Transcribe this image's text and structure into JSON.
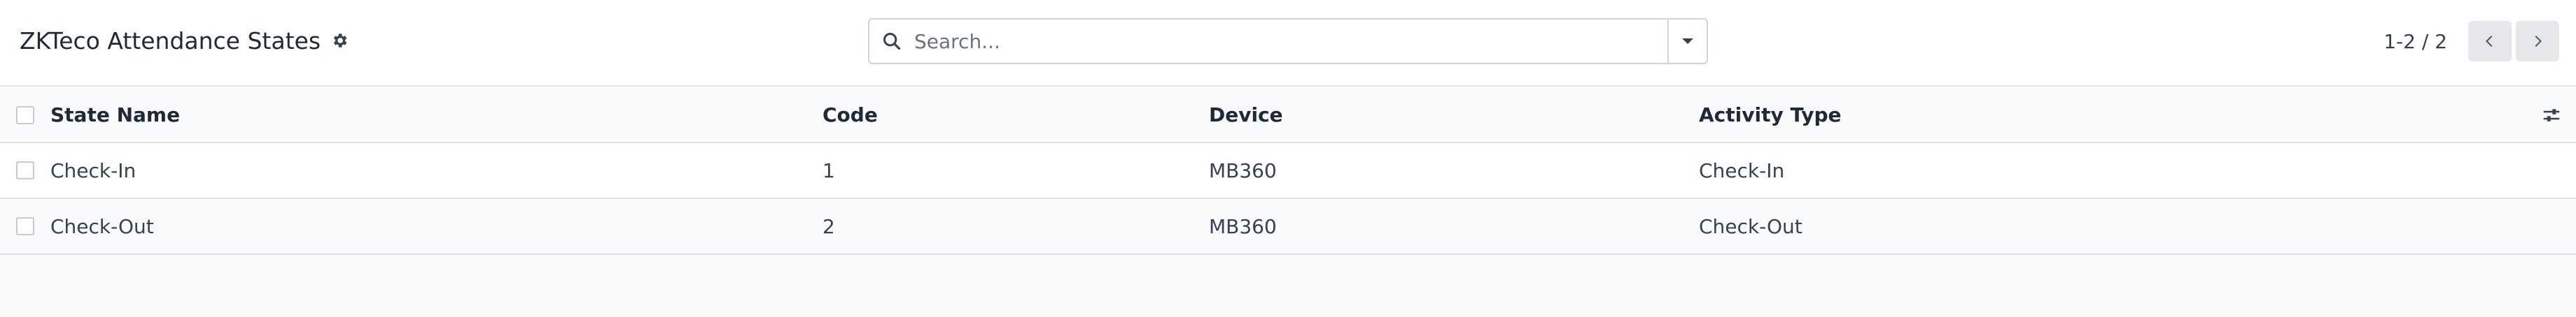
{
  "header": {
    "title": "ZKTeco Attendance States",
    "settings_icon": "gear-icon"
  },
  "search": {
    "placeholder": "Search...",
    "value": "",
    "icon": "search-icon",
    "toggle_icon": "caret-down-icon"
  },
  "pager": {
    "value": "1-2 / 2",
    "prev_icon": "chevron-left-icon",
    "next_icon": "chevron-right-icon"
  },
  "table": {
    "columns": [
      "State Name",
      "Code",
      "Device",
      "Activity Type"
    ],
    "optional_columns_icon": "sliders-icon",
    "rows": [
      {
        "state_name": "Check-In",
        "code": "1",
        "device": "MB360",
        "activity_type": "Check-In"
      },
      {
        "state_name": "Check-Out",
        "code": "2",
        "device": "MB360",
        "activity_type": "Check-Out"
      }
    ]
  }
}
